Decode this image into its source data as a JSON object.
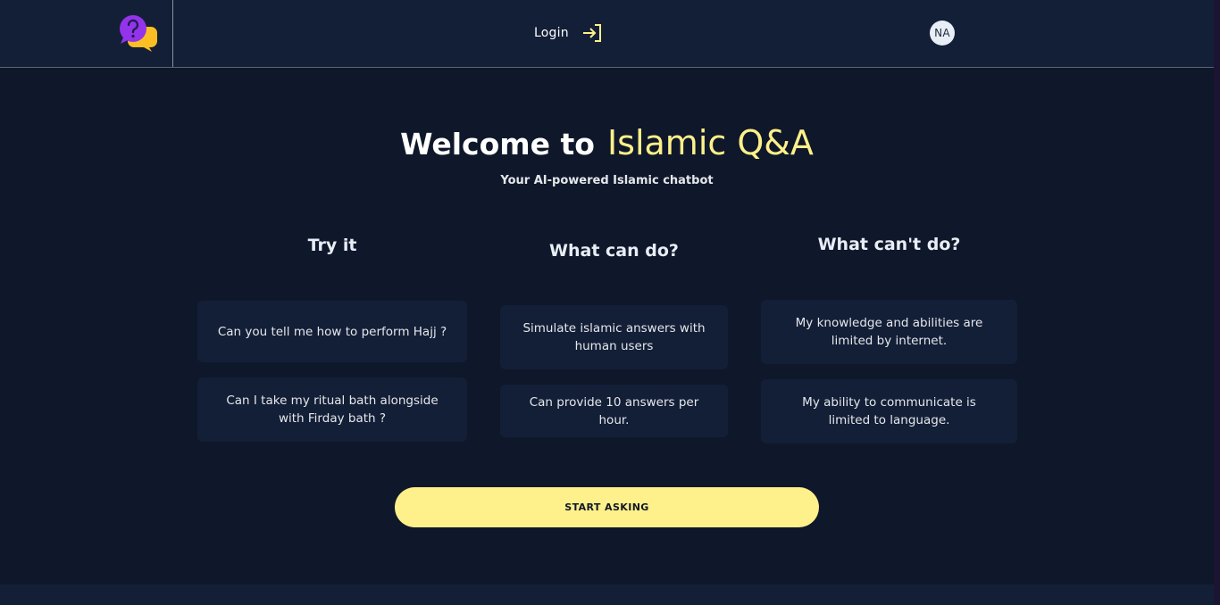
{
  "header": {
    "login_label": "Login",
    "avatar_initials": "NA"
  },
  "hero": {
    "welcome": "Welcome to",
    "brand": "Islamic Q&A",
    "subtitle": "Your AI-powered Islamic chatbot"
  },
  "columns": [
    {
      "heading": "Try it",
      "cards": [
        "Can you tell me how to perform Hajj ?",
        "Can I take my ritual bath alongside with Firday bath ?"
      ]
    },
    {
      "heading": "What can do?",
      "cards": [
        "Simulate islamic answers with human users",
        "Can provide 10 answers per hour."
      ]
    },
    {
      "heading": "What can't do?",
      "cards": [
        "My knowledge and abilities are limited by internet.",
        "My ability to communicate is limited to language."
      ]
    }
  ],
  "cta": {
    "label": "START ASKING"
  },
  "colors": {
    "background": "#0f172a",
    "panel": "#131f37",
    "accent": "#fef08a",
    "logo_primary": "#9333ea",
    "logo_secondary": "#fbbf24"
  },
  "icons": {
    "logo": "question-chat-bubbles-icon",
    "login": "sign-in-arrow-icon"
  }
}
